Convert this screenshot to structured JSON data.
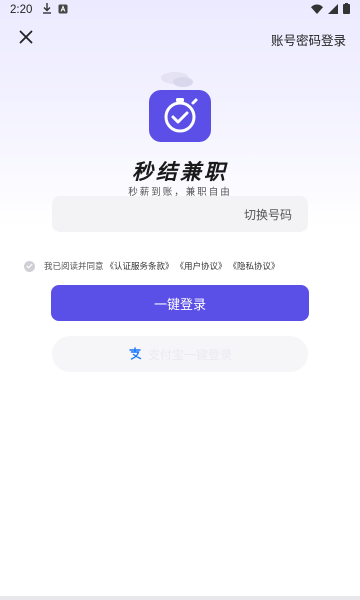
{
  "status_bar": {
    "time": "2:20",
    "left_icons": [
      "download-icon",
      "app-a-icon"
    ],
    "right_icons": [
      "wifi-icon",
      "signal-icon",
      "battery-icon"
    ]
  },
  "topbar": {
    "close_icon": "close-icon",
    "password_login": "账号密码登录"
  },
  "brand": {
    "logo_icon": "stopwatch-check-icon",
    "title": "秒结兼职",
    "subtitle": "秒薪到账，兼职自由"
  },
  "phone": {
    "number": "",
    "switch_label": "切换号码"
  },
  "agreement": {
    "prefix": "我已阅读并同意",
    "links": [
      "《认证服务条款》",
      "《用户协议》",
      "《隐私协议》"
    ]
  },
  "actions": {
    "one_click_login": "一键登录",
    "alipay_login": "支付宝一键登录"
  },
  "colors": {
    "primary": "#5a4fe6",
    "logo_bg": "#5b4fe8"
  }
}
